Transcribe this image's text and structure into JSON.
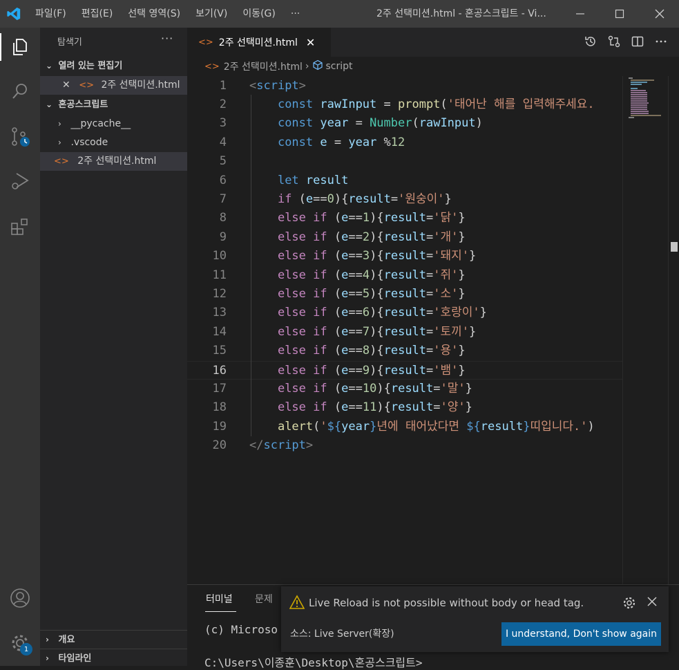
{
  "window": {
    "title": "2주 선택미션.html - 혼공스크립트 - Vi...",
    "menu": [
      "파일(F)",
      "편집(E)",
      "선택 영역(S)",
      "보기(V)",
      "이동(G)",
      "···"
    ]
  },
  "sidebar": {
    "title": "탐색기",
    "more": "···",
    "open_editors_header": "열려 있는 편집기",
    "open_editor_file": "2주 선택미션.html",
    "folder_header": "혼공스크립트",
    "items": [
      "__pycache__",
      ".vscode",
      "2주 선택미션.html"
    ],
    "outline_header": "개요",
    "timeline_header": "타임라인"
  },
  "editor": {
    "tab_label": "2주 선택미션.html",
    "breadcrumb_file": "2주 선택미션.html",
    "breadcrumb_symbol": "script",
    "current_line": 16,
    "lines": [
      [
        [
          "tag",
          "<"
        ],
        [
          "k",
          "script"
        ],
        [
          "tag",
          ">"
        ]
      ],
      [
        [
          "p",
          "    "
        ],
        [
          "k",
          "const"
        ],
        [
          "p",
          " "
        ],
        [
          "v",
          "rawInput"
        ],
        [
          "p",
          " = "
        ],
        [
          "f",
          "prompt"
        ],
        [
          "p",
          "("
        ],
        [
          "s",
          "'태어난 해를 입력해주세요."
        ]
      ],
      [
        [
          "p",
          "    "
        ],
        [
          "k",
          "const"
        ],
        [
          "p",
          " "
        ],
        [
          "v",
          "year"
        ],
        [
          "p",
          " = "
        ],
        [
          "t",
          "Number"
        ],
        [
          "p",
          "("
        ],
        [
          "v",
          "rawInput"
        ],
        [
          "p",
          ")"
        ]
      ],
      [
        [
          "p",
          "    "
        ],
        [
          "k",
          "const"
        ],
        [
          "p",
          " "
        ],
        [
          "v",
          "e"
        ],
        [
          "p",
          " = "
        ],
        [
          "v",
          "year"
        ],
        [
          "p",
          " %"
        ],
        [
          "n",
          "12"
        ]
      ],
      [],
      [
        [
          "p",
          "    "
        ],
        [
          "k",
          "let"
        ],
        [
          "p",
          " "
        ],
        [
          "v",
          "result"
        ]
      ],
      [
        [
          "p",
          "    "
        ],
        [
          "c",
          "if"
        ],
        [
          "p",
          " ("
        ],
        [
          "v",
          "e"
        ],
        [
          "p",
          "=="
        ],
        [
          "n",
          "0"
        ],
        [
          "p",
          ")"
        ],
        [
          "p",
          "{"
        ],
        [
          "v",
          "result"
        ],
        [
          "p",
          "="
        ],
        [
          "s",
          "'원숭이'"
        ],
        [
          "p",
          "}"
        ]
      ],
      [
        [
          "p",
          "    "
        ],
        [
          "c",
          "else"
        ],
        [
          "p",
          " "
        ],
        [
          "c",
          "if"
        ],
        [
          "p",
          " ("
        ],
        [
          "v",
          "e"
        ],
        [
          "p",
          "=="
        ],
        [
          "n",
          "1"
        ],
        [
          "p",
          ")"
        ],
        [
          "p",
          "{"
        ],
        [
          "v",
          "result"
        ],
        [
          "p",
          "="
        ],
        [
          "s",
          "'닭'"
        ],
        [
          "p",
          "}"
        ]
      ],
      [
        [
          "p",
          "    "
        ],
        [
          "c",
          "else"
        ],
        [
          "p",
          " "
        ],
        [
          "c",
          "if"
        ],
        [
          "p",
          " ("
        ],
        [
          "v",
          "e"
        ],
        [
          "p",
          "=="
        ],
        [
          "n",
          "2"
        ],
        [
          "p",
          ")"
        ],
        [
          "p",
          "{"
        ],
        [
          "v",
          "result"
        ],
        [
          "p",
          "="
        ],
        [
          "s",
          "'개'"
        ],
        [
          "p",
          "}"
        ]
      ],
      [
        [
          "p",
          "    "
        ],
        [
          "c",
          "else"
        ],
        [
          "p",
          " "
        ],
        [
          "c",
          "if"
        ],
        [
          "p",
          " ("
        ],
        [
          "v",
          "e"
        ],
        [
          "p",
          "=="
        ],
        [
          "n",
          "3"
        ],
        [
          "p",
          ")"
        ],
        [
          "p",
          "{"
        ],
        [
          "v",
          "result"
        ],
        [
          "p",
          "="
        ],
        [
          "s",
          "'돼지'"
        ],
        [
          "p",
          "}"
        ]
      ],
      [
        [
          "p",
          "    "
        ],
        [
          "c",
          "else"
        ],
        [
          "p",
          " "
        ],
        [
          "c",
          "if"
        ],
        [
          "p",
          " ("
        ],
        [
          "v",
          "e"
        ],
        [
          "p",
          "=="
        ],
        [
          "n",
          "4"
        ],
        [
          "p",
          ")"
        ],
        [
          "p",
          "{"
        ],
        [
          "v",
          "result"
        ],
        [
          "p",
          "="
        ],
        [
          "s",
          "'쥐'"
        ],
        [
          "p",
          "}"
        ]
      ],
      [
        [
          "p",
          "    "
        ],
        [
          "c",
          "else"
        ],
        [
          "p",
          " "
        ],
        [
          "c",
          "if"
        ],
        [
          "p",
          " ("
        ],
        [
          "v",
          "e"
        ],
        [
          "p",
          "=="
        ],
        [
          "n",
          "5"
        ],
        [
          "p",
          ")"
        ],
        [
          "p",
          "{"
        ],
        [
          "v",
          "result"
        ],
        [
          "p",
          "="
        ],
        [
          "s",
          "'소'"
        ],
        [
          "p",
          "}"
        ]
      ],
      [
        [
          "p",
          "    "
        ],
        [
          "c",
          "else"
        ],
        [
          "p",
          " "
        ],
        [
          "c",
          "if"
        ],
        [
          "p",
          " ("
        ],
        [
          "v",
          "e"
        ],
        [
          "p",
          "=="
        ],
        [
          "n",
          "6"
        ],
        [
          "p",
          ")"
        ],
        [
          "p",
          "{"
        ],
        [
          "v",
          "result"
        ],
        [
          "p",
          "="
        ],
        [
          "s",
          "'호랑이'"
        ],
        [
          "p",
          "}"
        ]
      ],
      [
        [
          "p",
          "    "
        ],
        [
          "c",
          "else"
        ],
        [
          "p",
          " "
        ],
        [
          "c",
          "if"
        ],
        [
          "p",
          " ("
        ],
        [
          "v",
          "e"
        ],
        [
          "p",
          "=="
        ],
        [
          "n",
          "7"
        ],
        [
          "p",
          ")"
        ],
        [
          "p",
          "{"
        ],
        [
          "v",
          "result"
        ],
        [
          "p",
          "="
        ],
        [
          "s",
          "'토끼'"
        ],
        [
          "p",
          "}"
        ]
      ],
      [
        [
          "p",
          "    "
        ],
        [
          "c",
          "else"
        ],
        [
          "p",
          " "
        ],
        [
          "c",
          "if"
        ],
        [
          "p",
          " ("
        ],
        [
          "v",
          "e"
        ],
        [
          "p",
          "=="
        ],
        [
          "n",
          "8"
        ],
        [
          "p",
          ")"
        ],
        [
          "p",
          "{"
        ],
        [
          "v",
          "result"
        ],
        [
          "p",
          "="
        ],
        [
          "s",
          "'용'"
        ],
        [
          "p",
          "}"
        ]
      ],
      [
        [
          "p",
          "    "
        ],
        [
          "c",
          "else"
        ],
        [
          "p",
          " "
        ],
        [
          "c",
          "if"
        ],
        [
          "p",
          " ("
        ],
        [
          "v",
          "e"
        ],
        [
          "p",
          "=="
        ],
        [
          "n",
          "9"
        ],
        [
          "p",
          ")"
        ],
        [
          "p",
          "{"
        ],
        [
          "v",
          "result"
        ],
        [
          "p",
          "="
        ],
        [
          "s",
          "'뱀'"
        ],
        [
          "p",
          "}"
        ]
      ],
      [
        [
          "p",
          "    "
        ],
        [
          "c",
          "else"
        ],
        [
          "p",
          " "
        ],
        [
          "c",
          "if"
        ],
        [
          "p",
          " ("
        ],
        [
          "v",
          "e"
        ],
        [
          "p",
          "=="
        ],
        [
          "n",
          "10"
        ],
        [
          "p",
          ")"
        ],
        [
          "p",
          "{"
        ],
        [
          "v",
          "result"
        ],
        [
          "p",
          "="
        ],
        [
          "s",
          "'말'"
        ],
        [
          "p",
          "}"
        ]
      ],
      [
        [
          "p",
          "    "
        ],
        [
          "c",
          "else"
        ],
        [
          "p",
          " "
        ],
        [
          "c",
          "if"
        ],
        [
          "p",
          " ("
        ],
        [
          "v",
          "e"
        ],
        [
          "p",
          "=="
        ],
        [
          "n",
          "11"
        ],
        [
          "p",
          ")"
        ],
        [
          "p",
          "{"
        ],
        [
          "v",
          "result"
        ],
        [
          "p",
          "="
        ],
        [
          "s",
          "'양'"
        ],
        [
          "p",
          "}"
        ]
      ],
      [
        [
          "p",
          "    "
        ],
        [
          "f",
          "alert"
        ],
        [
          "p",
          "("
        ],
        [
          "s",
          "'"
        ],
        [
          "k",
          "${"
        ],
        [
          "v",
          "year"
        ],
        [
          "k",
          "}"
        ],
        [
          "s",
          "년에 태어났다면 "
        ],
        [
          "k",
          "${"
        ],
        [
          "v",
          "result"
        ],
        [
          "k",
          "}"
        ],
        [
          "s",
          "띠입니다.'"
        ],
        [
          "p",
          ")"
        ]
      ],
      [
        [
          "tag",
          "</"
        ],
        [
          "k",
          "script"
        ],
        [
          "tag",
          ">"
        ]
      ]
    ]
  },
  "panel": {
    "tabs": [
      "터미널",
      "문제"
    ],
    "terminal_lines": [
      "(c) Microso",
      "C:\\Users\\이종훈\\Desktop\\혼공스크립트>"
    ]
  },
  "notification": {
    "message": "Live Reload is not possible without body or head tag.",
    "source": "소스: Live Server(확장)",
    "button": "I understand, Don't show again"
  },
  "badges": {
    "accounts_settings": "1"
  },
  "colors": {
    "accent": "#0e639c",
    "activity_bar": "#333333",
    "sidebar": "#252526",
    "editor": "#1e1e1e"
  }
}
